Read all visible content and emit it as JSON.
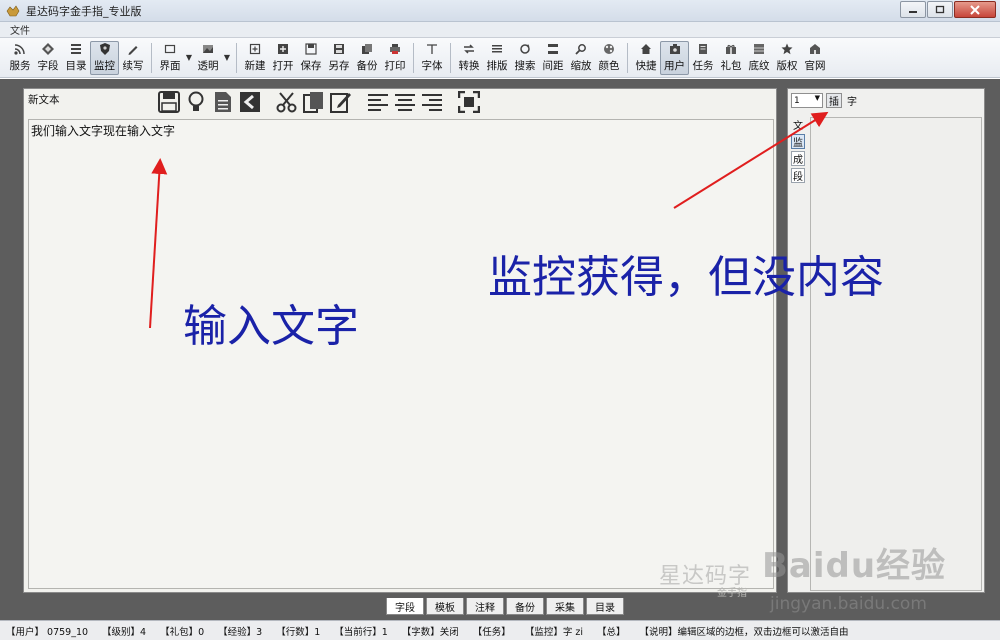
{
  "window": {
    "title": "星达码字金手指_专业版"
  },
  "menu": {
    "items": [
      "文件"
    ]
  },
  "toolbar": {
    "groups": [
      [
        "服务",
        "字段",
        "目录",
        "监控",
        "续写"
      ],
      [
        "界面",
        "透明"
      ],
      [
        "新建",
        "打开",
        "保存",
        "另存",
        "备份",
        "打印"
      ],
      [
        "字体"
      ],
      [
        "转换",
        "排版",
        "搜索",
        "间距",
        "缩放",
        "颜色"
      ],
      [
        "快捷",
        "用户",
        "任务",
        "礼包",
        "底纹",
        "版权",
        "官网"
      ]
    ],
    "active": [
      "监控",
      "用户"
    ]
  },
  "editor": {
    "doc_title": "新文本",
    "content": "我们输入文字现在输入文字",
    "icons": [
      "save-icon",
      "lightbulb-icon",
      "document-icon",
      "back-arrow-icon",
      "cut-icon",
      "copy-icon",
      "edit-icon",
      "align-left-icon",
      "align-center-icon",
      "align-right-icon",
      "fullscreen-icon"
    ]
  },
  "watermark": {
    "main": "星达码字",
    "sub": "金手指"
  },
  "side": {
    "select_value": "1",
    "insert_label": "插",
    "char_label": "字",
    "tabs": [
      "文",
      "监",
      "成",
      "段"
    ]
  },
  "bottom_tabs": {
    "items": [
      "字段",
      "模板",
      "注释",
      "备份",
      "采集",
      "目录"
    ],
    "active": "字段"
  },
  "status": {
    "items": [
      "【用户】 0759_10",
      "【级别】4",
      "【礼包】0",
      "【经验】3",
      "【行数】1",
      "【当前行】1",
      "【字数】关闭",
      "【任务】",
      "【监控】字 zi",
      "【总】",
      "【说明】编辑区域的边框，双击边框可以激活自由"
    ]
  },
  "annotations": {
    "left": "输入文字",
    "right": "监控获得，但没内容"
  },
  "baidu": {
    "logo": "Baidu经验",
    "url": "jingyan.baidu.com"
  },
  "colors": {
    "annotation": "#1a22a8",
    "arrow": "#e01e1e",
    "workspace": "#5d5d5d"
  }
}
